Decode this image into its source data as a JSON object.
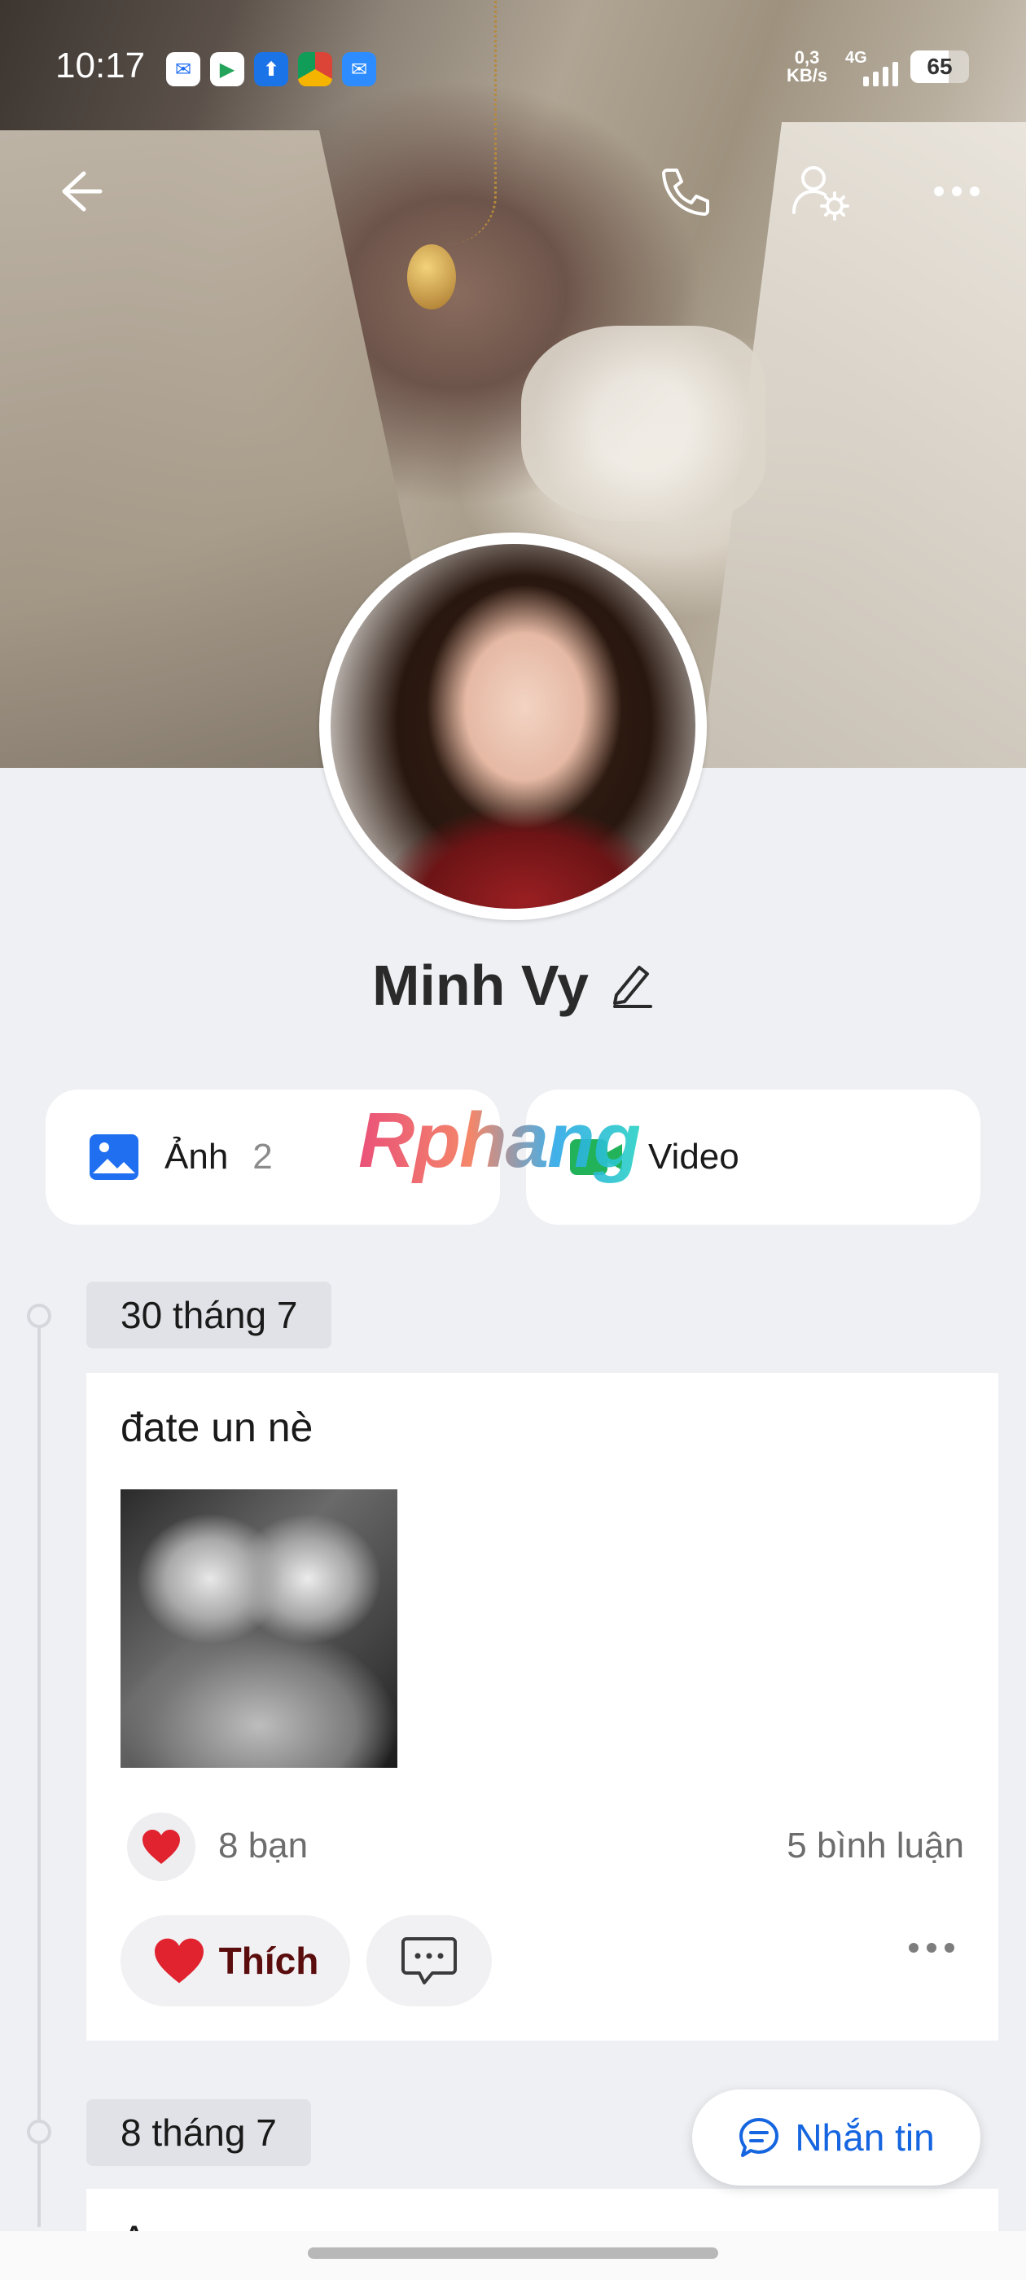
{
  "status_bar": {
    "time": "10:17",
    "net_speed_value": "0,3",
    "net_speed_unit": "KB/s",
    "network_type": "4G",
    "battery_level": "65",
    "notification_icons": [
      "messenger-icon",
      "play-store-icon",
      "upload-icon",
      "chrome-icon",
      "mail-icon"
    ]
  },
  "profile": {
    "name": "Minh Vy"
  },
  "media": {
    "photos_label": "Ảnh",
    "photos_count": "2",
    "videos_label": "Video"
  },
  "watermark": "Rphang",
  "timeline": [
    {
      "date": "30 tháng 7",
      "text": "đate un nè",
      "likes": "8 bạn",
      "comments": "5 bình luận",
      "like_label": "Thích"
    },
    {
      "date": "8 tháng 7",
      "text": "A",
      "cut_off": true
    }
  ],
  "message_button": "Nhắn tin",
  "colors": {
    "accent": "#1565e0",
    "background": "#eff0f4",
    "like": "#5b0d0d"
  }
}
